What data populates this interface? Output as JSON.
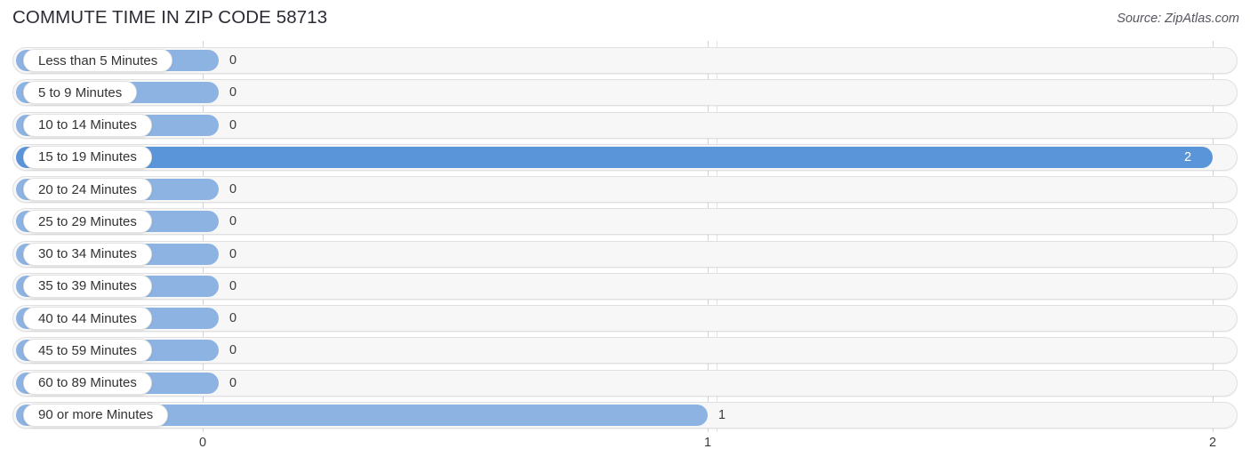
{
  "header": {
    "title": "COMMUTE TIME IN ZIP CODE 58713",
    "source": "Source: ZipAtlas.com"
  },
  "colors": {
    "bar_light": "#8cb3e2",
    "bar_strong": "#5b95d9",
    "track": "#f7f7f7",
    "track_border": "#e0e0e0",
    "gridline": "#d4d4d4",
    "title": "#2b2b35",
    "value_text": "#3b3b3b",
    "value_text_inside": "#ffffff"
  },
  "chart_data": {
    "type": "bar",
    "orientation": "horizontal",
    "title": "COMMUTE TIME IN ZIP CODE 58713",
    "xlabel": "",
    "ylabel": "",
    "xlim": [
      0,
      2
    ],
    "xticks": [
      0,
      1,
      2
    ],
    "xticklabels": [
      "0",
      "1",
      "2"
    ],
    "grid": true,
    "legend": false,
    "categories": [
      "Less than 5 Minutes",
      "5 to 9 Minutes",
      "10 to 14 Minutes",
      "15 to 19 Minutes",
      "20 to 24 Minutes",
      "25 to 29 Minutes",
      "30 to 34 Minutes",
      "35 to 39 Minutes",
      "40 to 44 Minutes",
      "45 to 59 Minutes",
      "60 to 89 Minutes",
      "90 or more Minutes"
    ],
    "values": [
      0,
      0,
      0,
      2,
      0,
      0,
      0,
      0,
      0,
      0,
      0,
      1
    ],
    "value_labels": [
      "0",
      "0",
      "0",
      "2",
      "0",
      "0",
      "0",
      "0",
      "0",
      "0",
      "0",
      "1"
    ],
    "highlighted_category": "15 to 19 Minutes"
  },
  "rows": [
    {
      "label": "Less than 5 Minutes",
      "value": 0,
      "value_label": "0",
      "highlight": false
    },
    {
      "label": "5 to 9 Minutes",
      "value": 0,
      "value_label": "0",
      "highlight": false
    },
    {
      "label": "10 to 14 Minutes",
      "value": 0,
      "value_label": "0",
      "highlight": false
    },
    {
      "label": "15 to 19 Minutes",
      "value": 2,
      "value_label": "2",
      "highlight": true
    },
    {
      "label": "20 to 24 Minutes",
      "value": 0,
      "value_label": "0",
      "highlight": false
    },
    {
      "label": "25 to 29 Minutes",
      "value": 0,
      "value_label": "0",
      "highlight": false
    },
    {
      "label": "30 to 34 Minutes",
      "value": 0,
      "value_label": "0",
      "highlight": false
    },
    {
      "label": "35 to 39 Minutes",
      "value": 0,
      "value_label": "0",
      "highlight": false
    },
    {
      "label": "40 to 44 Minutes",
      "value": 0,
      "value_label": "0",
      "highlight": false
    },
    {
      "label": "45 to 59 Minutes",
      "value": 0,
      "value_label": "0",
      "highlight": false
    },
    {
      "label": "60 to 89 Minutes",
      "value": 0,
      "value_label": "0",
      "highlight": false
    },
    {
      "label": "90 or more Minutes",
      "value": 1,
      "value_label": "1",
      "highlight": false
    }
  ],
  "axis": {
    "ticks": [
      {
        "label": "0",
        "value": 0
      },
      {
        "label": "1",
        "value": 1
      },
      {
        "label": "2",
        "value": 2
      }
    ]
  }
}
